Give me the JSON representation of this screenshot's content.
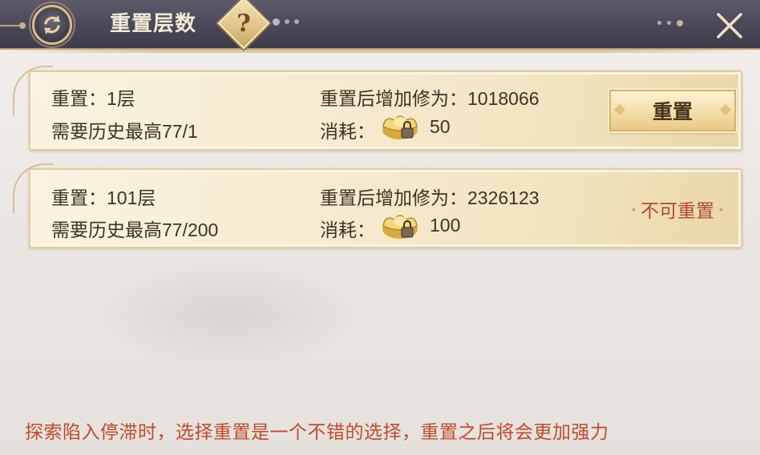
{
  "header": {
    "title": "重置层数",
    "help_glyph": "?",
    "refresh_icon": "refresh-icon",
    "close_icon": "close-icon"
  },
  "cards": [
    {
      "floor_label": "重置：1层",
      "requirement": "需要历史最高77/1",
      "gain_label": "重置后增加修为：1018066",
      "cost_label": "消耗：",
      "cost_icon": "gold-ingot-icon",
      "cost_value": "50",
      "action": {
        "type": "button",
        "label": "重置"
      }
    },
    {
      "floor_label": "重置：101层",
      "requirement": "需要历史最高77/200",
      "gain_label": "重置后增加修为：2326123",
      "cost_label": "消耗：",
      "cost_icon": "gold-ingot-icon",
      "cost_value": "100",
      "action": {
        "type": "label",
        "label": "不可重置"
      }
    }
  ],
  "hint": "探索陷入停滞时，选择重置是一个不错的选择，重置之后将会更加强力",
  "colors": {
    "hint": "#c24a2a",
    "disabled_label": "#b0492b",
    "header_bg": "#4a4858",
    "gold_border": "#d8bd86"
  }
}
